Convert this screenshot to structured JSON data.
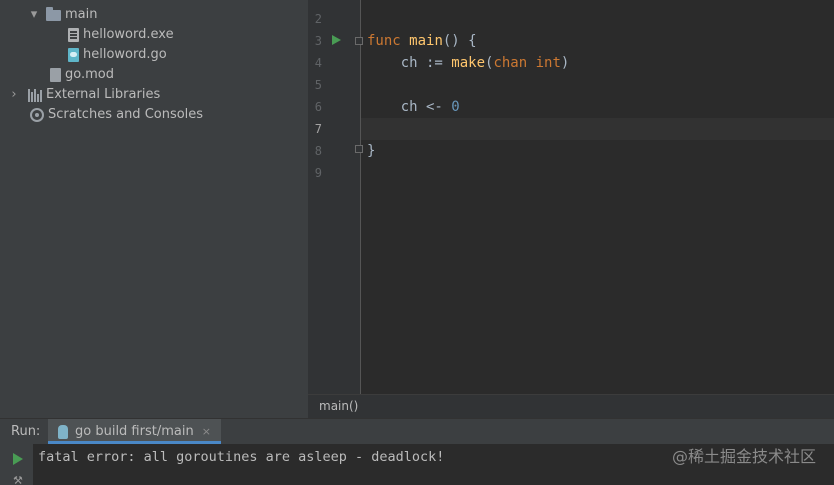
{
  "project_tree": {
    "items": [
      {
        "label": "main",
        "kind": "folder",
        "expanded": true
      },
      {
        "label": "helloword.exe",
        "kind": "exe-file"
      },
      {
        "label": "helloword.go",
        "kind": "go-file"
      },
      {
        "label": "go.mod",
        "kind": "mod-file"
      },
      {
        "label": "External Libraries",
        "kind": "libraries",
        "expanded": false
      },
      {
        "label": "Scratches and Consoles",
        "kind": "scratches"
      }
    ]
  },
  "editor": {
    "line_numbers": [
      "2",
      "3",
      "4",
      "5",
      "6",
      "7",
      "8",
      "9"
    ],
    "current_line": "7",
    "lines": {
      "l3": {
        "kw_func": "func ",
        "fn_main": "main",
        "rest": "() {"
      },
      "l4": {
        "indent": "    ch := ",
        "fn_make": "make",
        "paren_open": "(",
        "kw_chan": "chan",
        "space": " ",
        "kw_int": "int",
        "paren_close": ")"
      },
      "l6": {
        "indent": "    ch <- ",
        "num": "0"
      },
      "l8": {
        "brace": "}"
      }
    }
  },
  "breadcrumb": {
    "text": "main()"
  },
  "run_panel": {
    "label": "Run:",
    "tab_label": "go build first/main",
    "tab_close": "×",
    "output": "fatal error: all goroutines are asleep - deadlock!"
  },
  "watermark": "@稀土掘金技术社区",
  "colors": {
    "keyword": "#cc7832",
    "function": "#ffc66d",
    "number": "#6897bb",
    "run_green": "#499c54",
    "tab_underline": "#4a88c7"
  }
}
